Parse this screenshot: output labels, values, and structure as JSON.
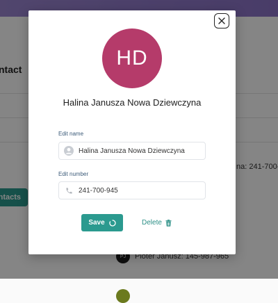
{
  "background": {
    "page_title_fragment": "ntact",
    "add_button_fragment": "ntacts",
    "contacts": [
      {
        "text": "na: 241-700-"
      },
      {
        "avatar_text": "PJ",
        "text": "Pioter Janusz: 145-987-965"
      }
    ]
  },
  "modal": {
    "avatar_initials": "HD",
    "contact_name": "Halina Janusza Nowa Dziewczyna",
    "name_label": "Edit name",
    "name_value": "Halina Janusza Nowa Dziewczyna",
    "number_label": "Edit number",
    "number_value": "241-700-945",
    "save_label": "Save",
    "delete_label": "Delete"
  },
  "colors": {
    "accent": "#2b9a8f",
    "avatar": "#b53b6a",
    "topbar": "#9b86d2"
  },
  "icons": [
    "close-icon",
    "user-icon",
    "phone-icon",
    "spinner-icon",
    "trash-icon"
  ]
}
